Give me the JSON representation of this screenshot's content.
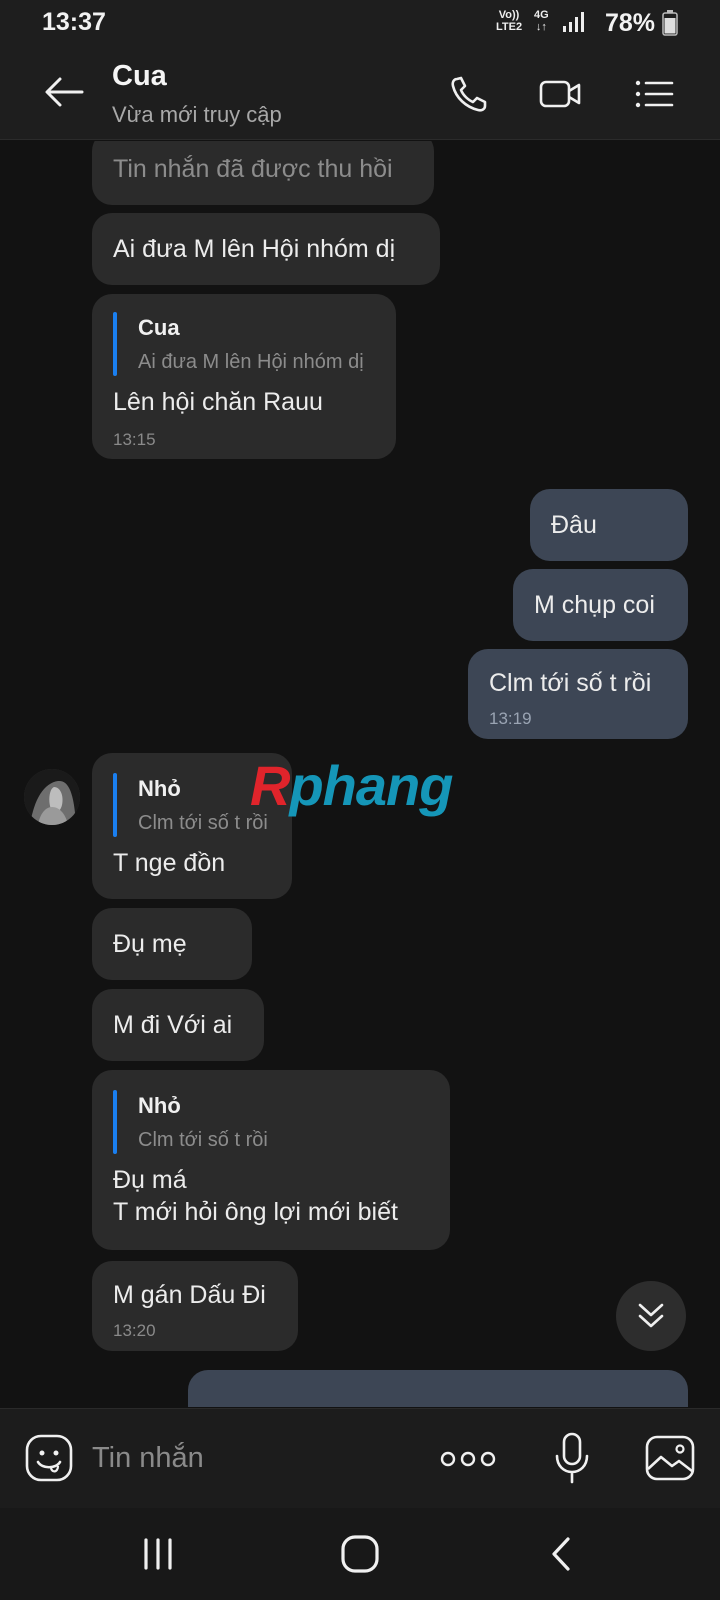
{
  "status_bar": {
    "time": "13:37",
    "volte_top": "Vo))",
    "volte_bottom": "LTE2",
    "network_top": "4G",
    "network_bottom": "↓↑",
    "battery": "78%",
    "icons": [
      "signal-icon",
      "battery-icon"
    ]
  },
  "header": {
    "name": "Cua",
    "status": "Vừa mới truy cập",
    "icons": [
      "back-arrow-icon",
      "phone-icon",
      "video-call-icon",
      "menu-list-icon"
    ]
  },
  "messages": [
    {
      "side": "in",
      "text": "Tin nhắn đã được thu hồi",
      "recalled": true
    },
    {
      "side": "in",
      "text": "Ai đưa M lên Hội nhóm dị"
    },
    {
      "side": "in",
      "quote_name": "Cua",
      "quote_text": "Ai đưa M lên Hội nhóm dị",
      "text": "Lên hội chăn Rauu",
      "time": "13:15"
    },
    {
      "side": "out",
      "text": "Đâu"
    },
    {
      "side": "out",
      "text": "M chụp coi"
    },
    {
      "side": "out",
      "text": "Clm tới số t rồi",
      "time": "13:19"
    },
    {
      "side": "in",
      "quote_name": "Nhỏ",
      "quote_text": "Clm tới số t rồi",
      "text": "T nge đồn"
    },
    {
      "side": "in",
      "text": "Đụ mẹ"
    },
    {
      "side": "in",
      "text": "M đi Với ai"
    },
    {
      "side": "in",
      "quote_name": "Nhỏ",
      "quote_text": "Clm tới số t rồi",
      "text_line1": "Đụ má",
      "text_line2": "T mới hỏi ông lợi mới biết"
    },
    {
      "side": "in",
      "text": "M gán Dấu Đi",
      "time": "13:20"
    }
  ],
  "watermark": {
    "first": "R",
    "rest": "phang"
  },
  "input": {
    "placeholder": "Tin nhắn",
    "icons": [
      "emoji-icon",
      "more-options-icon",
      "microphone-icon",
      "image-icon"
    ]
  },
  "navbar": {
    "icons": [
      "recent-apps-icon",
      "home-icon",
      "back-icon"
    ]
  },
  "colors": {
    "background": "#121212",
    "incoming_bubble": "#2b2b2b",
    "outgoing_bubble": "#3d4655",
    "quote_accent": "#1a7ff0",
    "watermark_red": "#e0242b",
    "watermark_blue": "#1596b8"
  }
}
